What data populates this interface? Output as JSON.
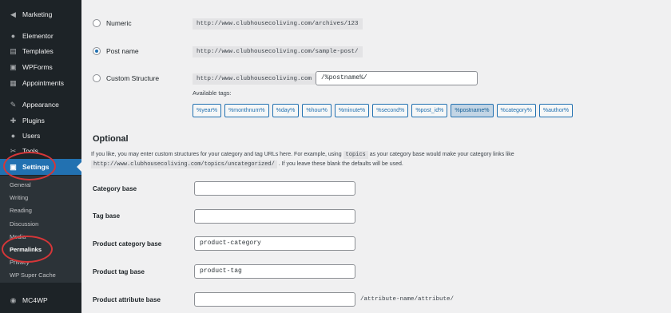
{
  "sidebar": {
    "items": [
      {
        "label": "Marketing",
        "icon": "megaphone-icon",
        "glyph": "◀"
      },
      {
        "label": "Elementor",
        "icon": "elementor-icon",
        "glyph": "●"
      },
      {
        "label": "Templates",
        "icon": "folder-icon",
        "glyph": "▤"
      },
      {
        "label": "WPForms",
        "icon": "form-icon",
        "glyph": "▣"
      },
      {
        "label": "Appointments",
        "icon": "calendar-icon",
        "glyph": "▦"
      },
      {
        "label": "Appearance",
        "icon": "paintbrush-icon",
        "glyph": "✎"
      },
      {
        "label": "Plugins",
        "icon": "plugin-icon",
        "glyph": "✚"
      },
      {
        "label": "Users",
        "icon": "user-icon",
        "glyph": "●"
      },
      {
        "label": "Tools",
        "icon": "wrench-icon",
        "glyph": "✂"
      },
      {
        "label": "Settings",
        "icon": "settings-icon",
        "glyph": "▣"
      },
      {
        "label": "MC4WP",
        "icon": "mc4wp-icon",
        "glyph": "◉"
      }
    ],
    "submenu": [
      "General",
      "Writing",
      "Reading",
      "Discussion",
      "Media",
      "Permalinks",
      "Privacy",
      "WP Super Cache"
    ]
  },
  "structures": {
    "numeric": {
      "label": "Numeric",
      "example": "http://www.clubhousecoliving.com/archives/123"
    },
    "postname": {
      "label": "Post name",
      "example": "http://www.clubhousecoliving.com/sample-post/"
    },
    "custom": {
      "label": "Custom Structure",
      "base": "http://www.clubhousecoliving.com",
      "value": "/%postname%/",
      "available_tags_label": "Available tags:"
    }
  },
  "tags": [
    "%year%",
    "%monthnum%",
    "%day%",
    "%hour%",
    "%minute%",
    "%second%",
    "%post_id%",
    "%postname%",
    "%category%",
    "%author%"
  ],
  "optional": {
    "heading": "Optional",
    "desc_part1": "If you like, you may enter custom structures for your category and tag URLs here. For example, using",
    "desc_code1": "topics",
    "desc_part2": "as your category base would make your category links like",
    "desc_code2": "http://www.clubhousecoliving.com/topics/uncategorized/",
    "desc_part3": ". If you leave these blank the defaults will be used.",
    "fields": [
      {
        "label": "Category base",
        "value": ""
      },
      {
        "label": "Tag base",
        "value": ""
      },
      {
        "label": "Product category base",
        "value": "product-category"
      },
      {
        "label": "Product tag base",
        "value": "product-tag"
      },
      {
        "label": "Product attribute base",
        "value": "",
        "suffix": "/attribute-name/attribute/"
      }
    ]
  },
  "colors": {
    "accent": "#2271b1",
    "annotation": "#d63638",
    "sidebar": "#1d2327"
  }
}
